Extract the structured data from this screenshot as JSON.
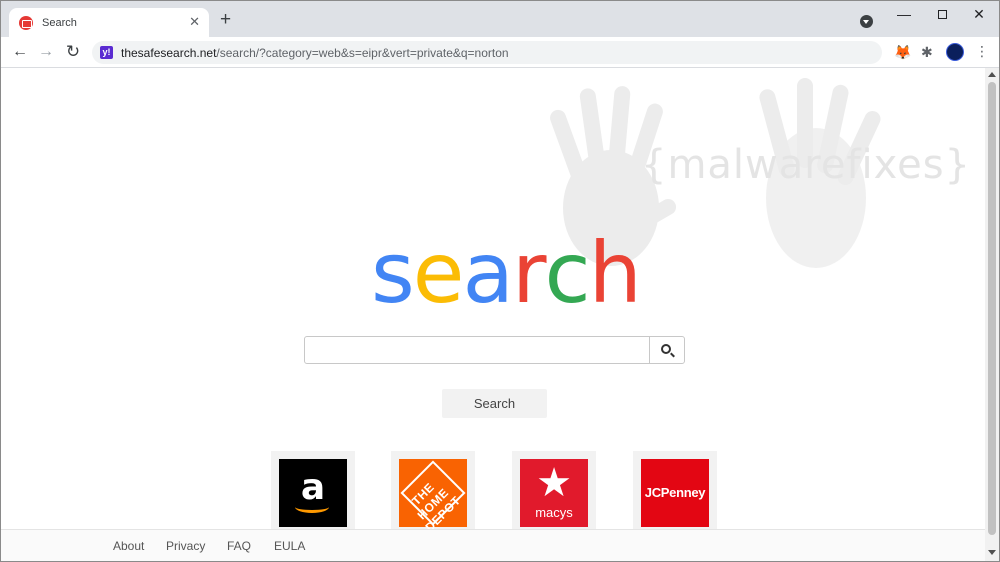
{
  "tab": {
    "title": "Search",
    "close": "✕",
    "new_tab": "+"
  },
  "window_controls": {
    "minimize": "—",
    "close": "✕"
  },
  "toolbar": {
    "back": "←",
    "forward": "→",
    "reload": "↻",
    "site_icon": "y!",
    "url_host": "thesafesearch.net",
    "url_path": "/search/?category=web&s=eipr&vert=private&q=norton",
    "menu": "⋮"
  },
  "watermark": {
    "text": "{malwarefixes}"
  },
  "logo": {
    "letters": [
      "s",
      "e",
      "a",
      "r",
      "c",
      "h"
    ],
    "colors": [
      "#4285f4",
      "#fbbc05",
      "#4285f4",
      "#ea4335",
      "#34a853",
      "#ea4335"
    ]
  },
  "search": {
    "value": "",
    "placeholder": "",
    "submit_label": "Search"
  },
  "shortcuts": [
    {
      "name": "Amazon",
      "glyph": "a"
    },
    {
      "name": "The Home Depot",
      "glyph": "THE HOME DEPOT"
    },
    {
      "name": "Macy's",
      "glyph": "★",
      "label": "macys"
    },
    {
      "name": "JCPenney",
      "label": "JCPenney"
    }
  ],
  "footer": {
    "links": [
      "About",
      "Privacy",
      "FAQ",
      "EULA"
    ]
  }
}
